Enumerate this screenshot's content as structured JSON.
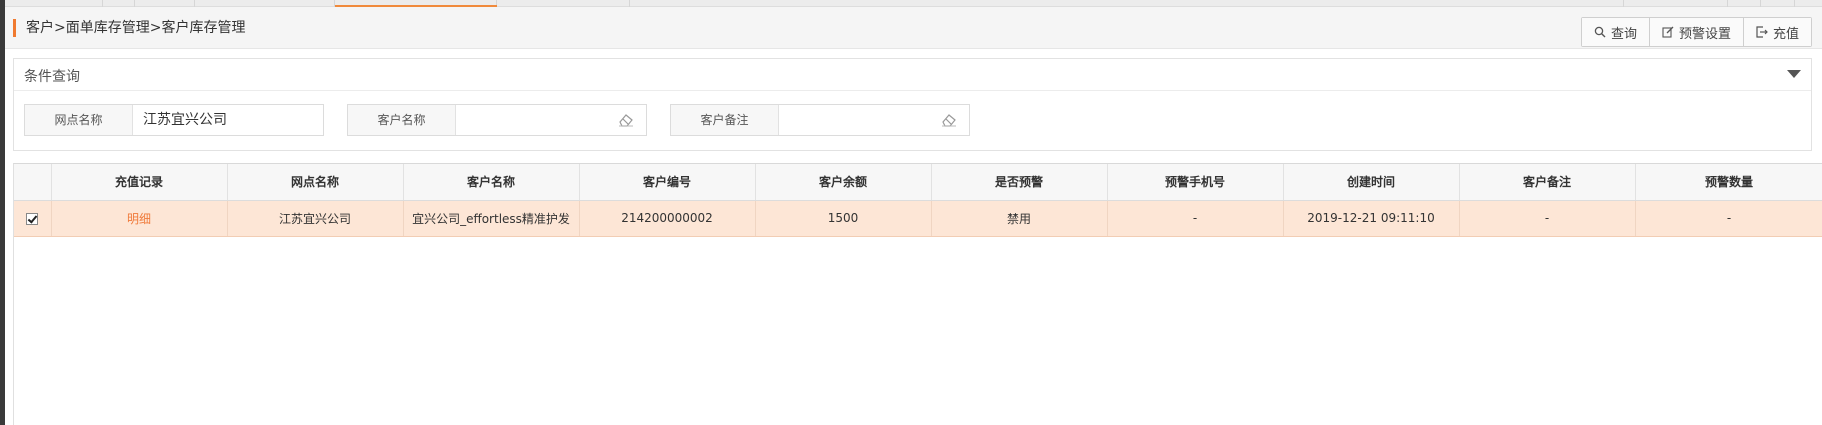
{
  "breadcrumb": "客户>面单库存管理>客户库存管理",
  "toolbar": {
    "query": "查询",
    "warn_setting": "预警设置",
    "recharge": "充值"
  },
  "query_panel": {
    "title": "条件查询",
    "fields": [
      {
        "label": "网点名称",
        "value": "江苏宜兴公司"
      },
      {
        "label": "客户名称",
        "value": ""
      },
      {
        "label": "客户备注",
        "value": ""
      }
    ]
  },
  "table": {
    "columns": [
      "充值记录",
      "网点名称",
      "客户名称",
      "客户编号",
      "客户余额",
      "是否预警",
      "预警手机号",
      "创建时间",
      "客户备注",
      "预警数量"
    ],
    "rows": [
      [
        "明细",
        "江苏宜兴公司",
        "宜兴公司_effortless精准护发",
        "214200000002",
        "1500",
        "禁用",
        "-",
        "2019-12-21 09:11:10",
        "-",
        "-"
      ]
    ]
  },
  "colors": {
    "accent": "#f07a30",
    "selected_row": "#fde6d6",
    "link": "#f07a3a"
  }
}
